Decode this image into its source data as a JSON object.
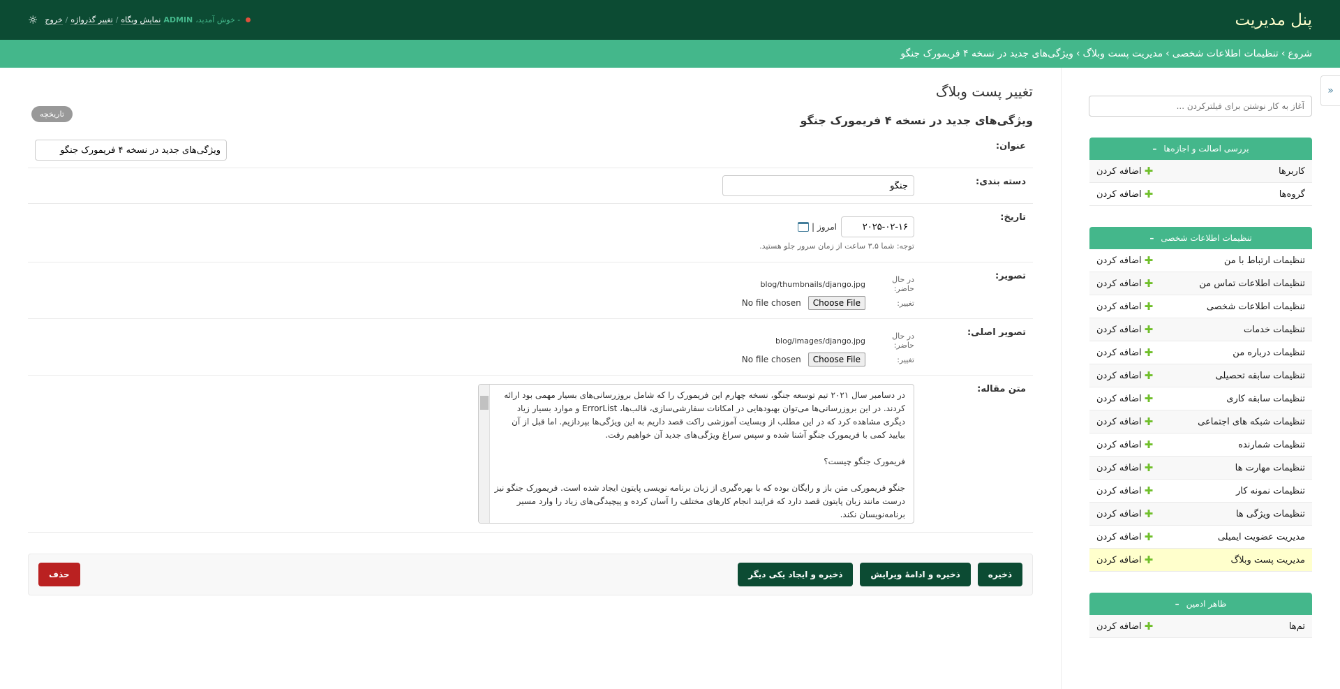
{
  "header": {
    "site_title": "پنل مدیریت",
    "welcome": "خوش آمدید،",
    "username": "ADMIN",
    "view_site": "نمایش وبگاه",
    "change_password": "تغییر گذرواژه",
    "logout": "خروج",
    "sep": "/"
  },
  "breadcrumbs": {
    "items": [
      "شروع",
      "تنظیمات اطلاعات شخصی",
      "مدیریت پست وبلاگ",
      "ویژگی‌های جدید در نسخه ۴ فریمورک جنگو"
    ],
    "sep": "›"
  },
  "sidebar": {
    "filter_placeholder": "آغاز به کار نوشتن برای فیلترکردن ...",
    "toggle": "«",
    "add_label": "اضافه کردن",
    "modules": [
      {
        "caption": "بررسی اصالت و اجازه‌ها",
        "models": [
          "کاربرها",
          "گروه‌ها"
        ]
      },
      {
        "caption": "تنظیمات اطلاعات شخصی",
        "models": [
          "تنظیمات ارتباط با من",
          "تنظیمات اطلاعات تماس من",
          "تنظیمات اطلاعات شخصی",
          "تنظیمات خدمات",
          "تنظیمات درباره من",
          "تنظیمات سابقه تحصیلی",
          "تنظیمات سابقه کاری",
          "تنظیمات شبکه های اجتماعی",
          "تنظیمات شمارنده",
          "تنظیمات مهارت ها",
          "تنظیمات نمونه کار",
          "تنظیمات ویژگی ها",
          "مدیریت عضویت ایمیلی",
          "مدیریت پست وبلاگ"
        ]
      },
      {
        "caption": "ظاهر ادمین",
        "models": [
          "تم‌ها"
        ]
      }
    ],
    "collapse_symbol": "–"
  },
  "main": {
    "page_title": "تغییر پست وبلاگ",
    "history": "تاریخچه",
    "object_title": "ویژگی‌های جدید در نسخه ۴ فریمورک جنگو",
    "fields": {
      "title_label": "عنوان:",
      "title_value": "ویژگی‌های جدید در نسخه ۴ فریمورک جنگو",
      "category_label": "دسته بندی:",
      "category_value": "جنگو",
      "date_label": "تاریخ:",
      "date_value": "۲۰۲۵-۰۲-۱۶",
      "today": "امروز",
      "date_sep": "|",
      "date_note": "توجه: شما ۳.۵ ساعت از زمان سرور جلو هستید.",
      "image_label": "تصویر:",
      "currently": "در حال حاضر:",
      "change": "تغییر:",
      "image_path": "blog/thumbnails/django.jpg",
      "original_image_label": "تصویر اصلی:",
      "original_image_path": "blog/images/django.jpg",
      "choose_file": "Choose File",
      "no_file": "No file chosen",
      "body_label": "متن مقاله:",
      "body_p1": "در دسامبر سال ۲۰۲۱ تیم توسعه جنگو، نسخه چهارم این فریمورک را که شامل بروزرسانی‌های بسیار مهمی بود ارائه کردند. در این بروزرسانی‌ها می‌توان بهبودهایی در امکانات سفارشی‌سازی، قالب‌ها، ErrorList و موارد بسیار زیاد دیگری مشاهده کرد که در این مطلب از وبسایت آموزشی راکت قصد داریم به این ویژگی‌ها بپردازیم. اما قبل از آن بیایید کمی با فریمورک جنگو آشنا شده و سپس سراغ ویژگی‌های جدید آن خواهیم رفت.",
      "body_p2": "فریمورک جنگو چیست؟",
      "body_p3": "جنگو فریمورکی متن باز و رایگان بوده که با بهره‌گیری از زبان برنامه نویسی پایتون ایجاد شده است. فریمورک جنگو نیز درست مانند زبان پایتون قصد دارد که فرایند انجام کارهای مختلف را آسان کرده و پیچیدگی‌های زیاد را وارد مسیر برنامه‌نویسان نکند."
    },
    "buttons": {
      "save": "ذخیره",
      "save_continue": "ذخیره و ادامهٔ ویرایش",
      "save_add": "ذخیره و ایجاد یکی دیگر",
      "delete": "حذف"
    }
  }
}
